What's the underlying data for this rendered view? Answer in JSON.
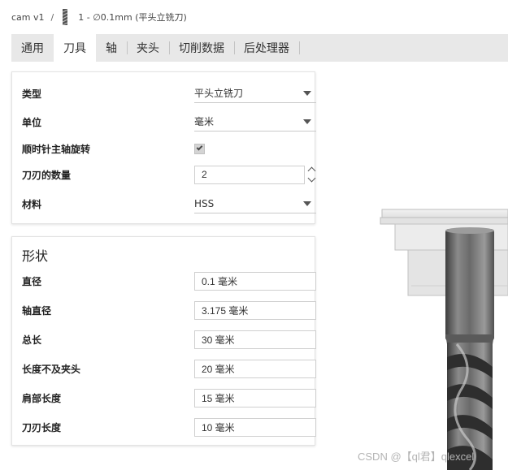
{
  "breadcrumb": {
    "project": "cam v1",
    "separator": "/",
    "tool": "1 - ∅0.1mm (平头立铣刀)"
  },
  "tabs": [
    {
      "label": "通用",
      "active": false
    },
    {
      "label": "刀具",
      "active": true
    },
    {
      "label": "轴",
      "active": false
    },
    {
      "label": "夹头",
      "active": false
    },
    {
      "label": "切削数据",
      "active": false
    },
    {
      "label": "后处理器",
      "active": false
    }
  ],
  "properties": {
    "type": {
      "label": "类型",
      "value": "平头立铣刀"
    },
    "unit": {
      "label": "单位",
      "value": "毫米"
    },
    "clockwise": {
      "label": "顺时针主轴旋转",
      "checked": true
    },
    "flutes": {
      "label": "刀刃的数量",
      "value": "2"
    },
    "material": {
      "label": "材料",
      "value": "HSS"
    }
  },
  "shape": {
    "title": "形状",
    "diameter": {
      "label": "直径",
      "value": "0.1 毫米"
    },
    "shaft_diameter": {
      "label": "轴直径",
      "value": "3.175 毫米"
    },
    "overall_length": {
      "label": "总长",
      "value": "30 毫米"
    },
    "length_below_holder": {
      "label": "长度不及夹头",
      "value": "20 毫米"
    },
    "shoulder_length": {
      "label": "肩部长度",
      "value": "15 毫米"
    },
    "flute_length": {
      "label": "刀刃长度",
      "value": "10 毫米"
    }
  },
  "watermark": "CSDN @【ql君】qlexcel",
  "colors": {
    "tab_bar": "#e8e8e8",
    "active_tab": "#ffffff",
    "panel_border": "#e3e3e3",
    "holder": "#e6e6e6",
    "tool_steel": "#7a7a7a"
  }
}
